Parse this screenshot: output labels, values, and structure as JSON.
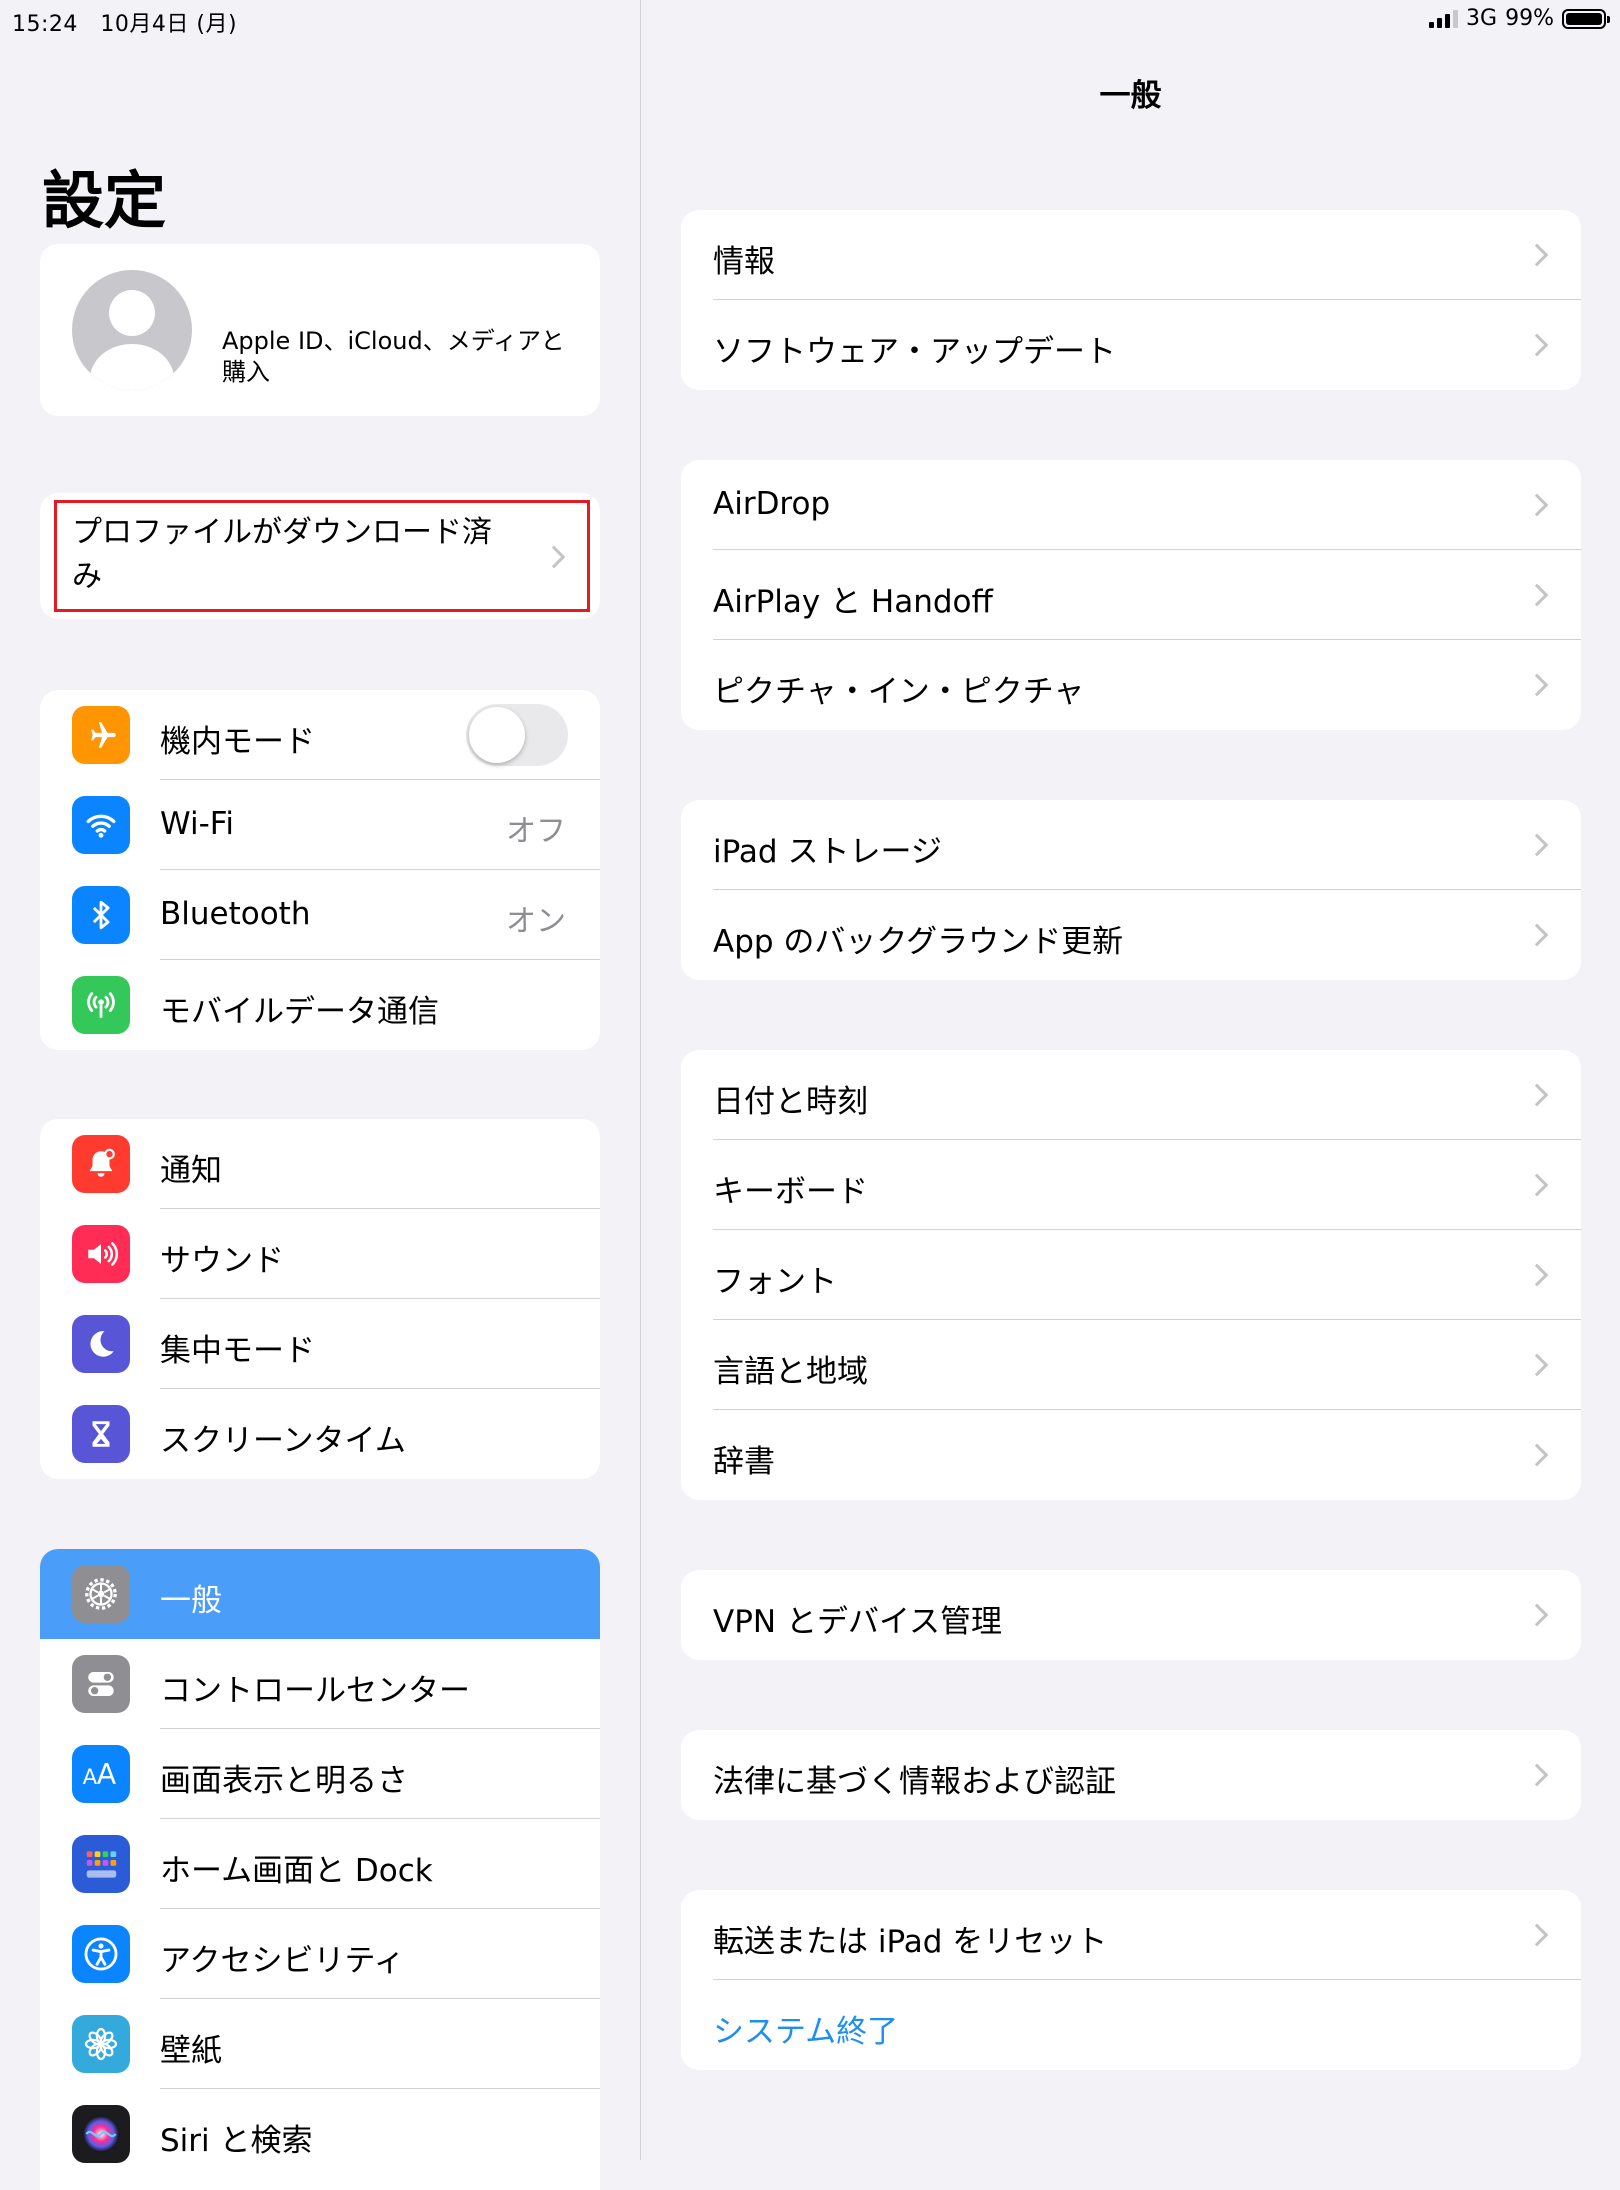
{
  "status_bar": {
    "time": "15:24",
    "date": "10月4日 (月)",
    "network": "3G",
    "battery": "99%",
    "battery_level": 0.99
  },
  "sidebar": {
    "title": "設定",
    "profile_text": "Apple ID、iCloud、メディアと購入",
    "profile_downloaded": "プロファイルがダウンロード済み",
    "groups": [
      [
        {
          "label": "機内モード",
          "icon": "airplane-icon",
          "color": "#ff9500",
          "toggle": false
        },
        {
          "label": "Wi-Fi",
          "icon": "wifi-icon",
          "color": "#0a84ff",
          "value": "オフ"
        },
        {
          "label": "Bluetooth",
          "icon": "bluetooth-icon",
          "color": "#0a84ff",
          "value": "オン"
        },
        {
          "label": "モバイルデータ通信",
          "icon": "antenna-icon",
          "color": "#34c759"
        }
      ],
      [
        {
          "label": "通知",
          "icon": "bell-icon",
          "color": "#ff3b30"
        },
        {
          "label": "サウンド",
          "icon": "speaker-icon",
          "color": "#ff2d55"
        },
        {
          "label": "集中モード",
          "icon": "moon-icon",
          "color": "#5856d6"
        },
        {
          "label": "スクリーンタイム",
          "icon": "hourglass-icon",
          "color": "#5856d6"
        }
      ],
      [
        {
          "label": "一般",
          "icon": "gear-icon",
          "color": "#8e8e93",
          "selected": true
        },
        {
          "label": "コントロールセンター",
          "icon": "switches-icon",
          "color": "#8e8e93"
        },
        {
          "label": "画面表示と明るさ",
          "icon": "text-size-icon",
          "color": "#0a84ff"
        },
        {
          "label": "ホーム画面と Dock",
          "icon": "grid-icon",
          "color": "#2c5bd8"
        },
        {
          "label": "アクセシビリティ",
          "icon": "accessibility-icon",
          "color": "#0a84ff"
        },
        {
          "label": "壁紙",
          "icon": "flower-icon",
          "color": "#34aadc"
        },
        {
          "label": "Siri と検索",
          "icon": "siri-icon",
          "color": "#1c1c1e"
        }
      ]
    ]
  },
  "detail": {
    "title": "一般",
    "groups": [
      [
        {
          "label": "情報"
        },
        {
          "label": "ソフトウェア・アップデート"
        }
      ],
      [
        {
          "label": "AirDrop"
        },
        {
          "label": "AirPlay と Handoff"
        },
        {
          "label": "ピクチャ・イン・ピクチャ"
        }
      ],
      [
        {
          "label": "iPad ストレージ"
        },
        {
          "label": "App のバックグラウンド更新"
        }
      ],
      [
        {
          "label": "日付と時刻"
        },
        {
          "label": "キーボード"
        },
        {
          "label": "フォント"
        },
        {
          "label": "言語と地域"
        },
        {
          "label": "辞書"
        }
      ],
      [
        {
          "label": "VPN とデバイス管理"
        }
      ],
      [
        {
          "label": "法律に基づく情報および認証"
        }
      ],
      [
        {
          "label": "転送または iPad をリセット"
        },
        {
          "label": "システム終了",
          "link": true,
          "no_chevron": true
        }
      ]
    ]
  }
}
